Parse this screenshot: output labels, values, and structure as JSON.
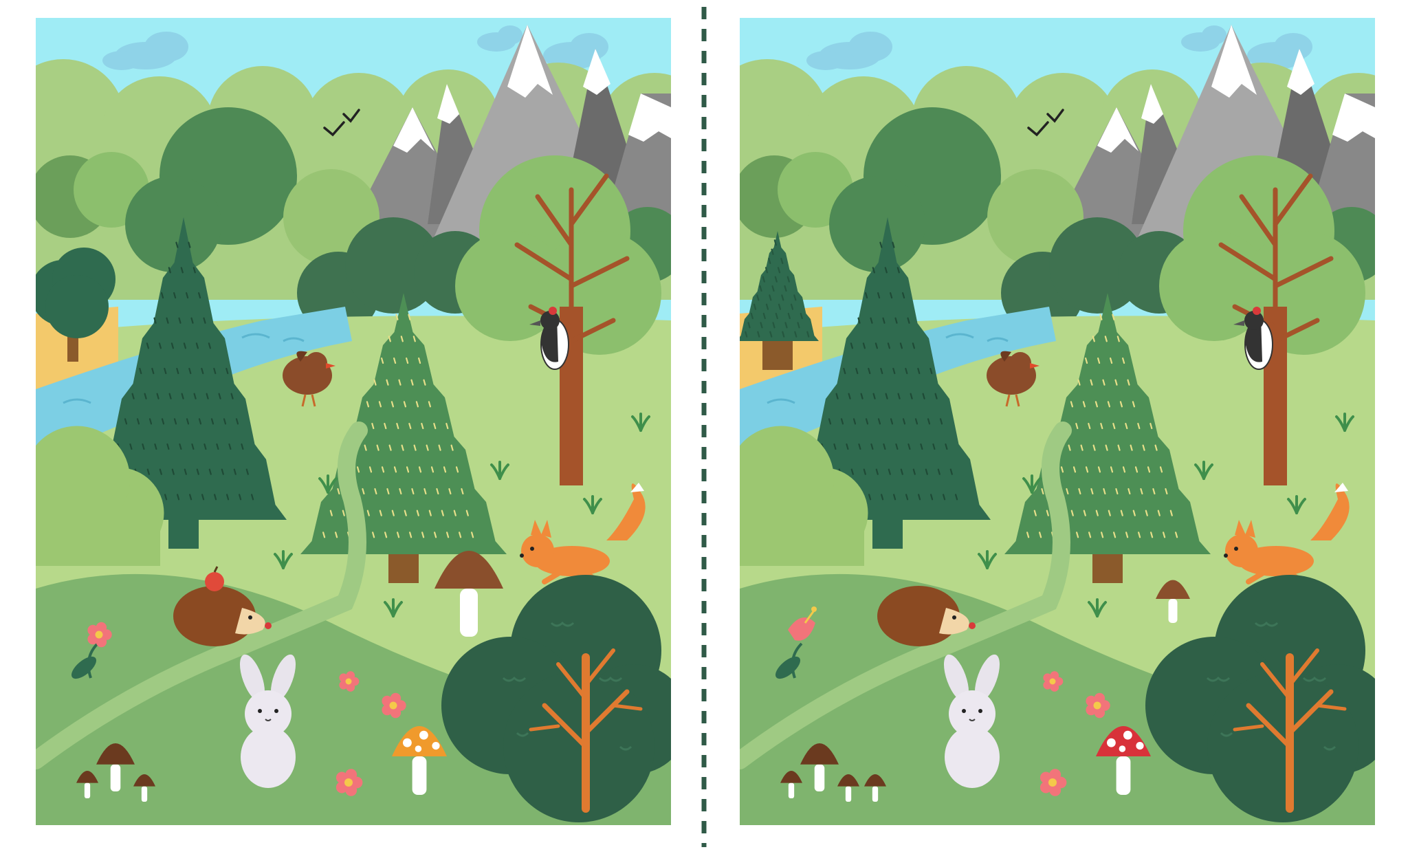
{
  "puzzle": {
    "type": "spot-the-difference",
    "scene": "forest",
    "left_panel": "original",
    "right_panel": "modified"
  },
  "colors": {
    "sky": "#9fecf5",
    "cloud": "#8fd3e8",
    "river": "#7ccfe4",
    "dark_tree": "#2f6b4f",
    "light_tree": "#4d8f55",
    "meadow": "#b7d98a",
    "hill": "#7fb46e",
    "divider": "#2f5a47"
  },
  "scene_objects": [
    "clouds-icon",
    "birds-icon",
    "mountains",
    "river",
    "dark-fir-tree",
    "light-fir-tree",
    "deciduous-tree",
    "woodpecker-icon",
    "robin-icon",
    "squirrel-icon",
    "hedgehog-icon",
    "rabbit-icon",
    "brown-mushroom-icon",
    "spotted-mushroom-icon",
    "flower-icon",
    "dark-bush",
    "orange-tree"
  ]
}
